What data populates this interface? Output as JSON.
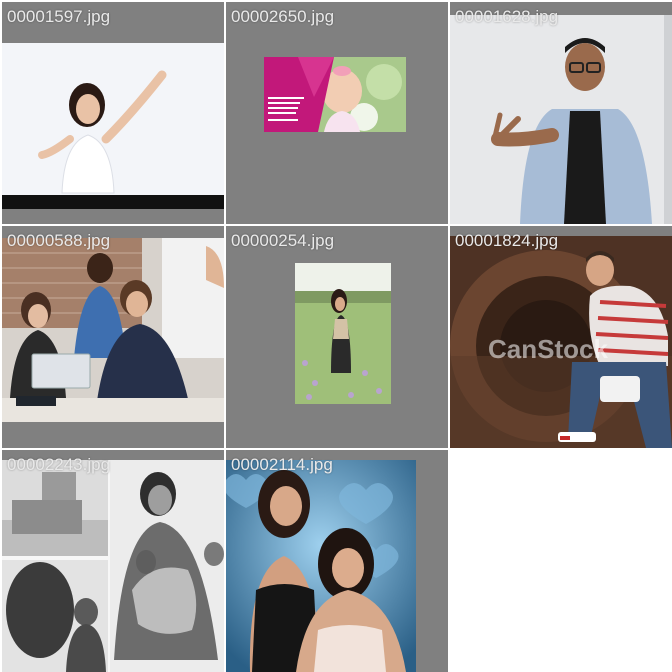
{
  "gallery": {
    "tiles": [
      {
        "name": "00001597.jpg"
      },
      {
        "name": "00002650.jpg"
      },
      {
        "name": "00001628.jpg"
      },
      {
        "name": "00000588.jpg"
      },
      {
        "name": "00000254.jpg"
      },
      {
        "name": "00001824.jpg"
      },
      {
        "name": "00002243.jpg"
      },
      {
        "name": "00002114.jpg"
      }
    ]
  },
  "colors": {
    "tile_background": "#808080",
    "filename_text": "#e9e9e9",
    "page_background": "#ffffff"
  },
  "tile_watermarks": {
    "canstock": "CanStock"
  }
}
